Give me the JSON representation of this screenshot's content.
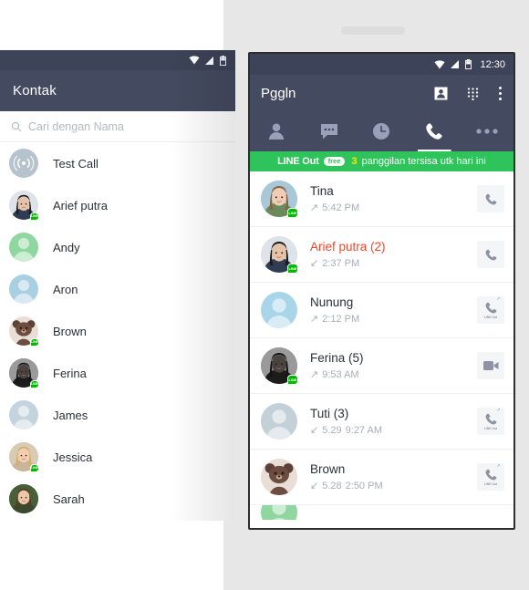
{
  "left_phone": {
    "status_bar": {
      "icons": [
        "wifi-icon",
        "signal-icon",
        "battery-icon"
      ]
    },
    "header": {
      "title": "Kontak"
    },
    "search": {
      "placeholder": "Cari dengan Nama",
      "icon": "search-icon"
    },
    "contacts": [
      {
        "name": "Test Call",
        "avatar": "broadcast",
        "avatar_color": "#b6c2cc",
        "line_badge": false
      },
      {
        "name": "Arief putra",
        "avatar": "photo-man",
        "avatar_color": "#d9dde2",
        "line_badge": true
      },
      {
        "name": "Andy",
        "avatar": "person",
        "avatar_color": "#8fd6a0",
        "line_badge": false
      },
      {
        "name": "Aron",
        "avatar": "person",
        "avatar_color": "#a9cfe2",
        "line_badge": false
      },
      {
        "name": "Brown",
        "avatar": "bear",
        "avatar_color": "#e8ded5",
        "line_badge": true
      },
      {
        "name": "Ferina",
        "avatar": "photo-dark",
        "avatar_color": "#3a3a3a",
        "line_badge": true
      },
      {
        "name": "James",
        "avatar": "person",
        "avatar_color": "#c3d4de",
        "line_badge": false
      },
      {
        "name": "Jessica",
        "avatar": "photo-blonde",
        "avatar_color": "#e3c9a6",
        "line_badge": true
      },
      {
        "name": "Sarah",
        "avatar": "photo-brunette",
        "avatar_color": "#5c6b4a",
        "line_badge": false
      }
    ]
  },
  "right_phone": {
    "status_bar": {
      "time": "12:30",
      "icons": [
        "wifi-icon",
        "signal-icon",
        "battery-icon"
      ]
    },
    "header": {
      "title": "Pggln",
      "icons": [
        "contact-card-icon",
        "dialpad-icon",
        "overflow-menu-icon"
      ]
    },
    "tabs": [
      {
        "name": "friends",
        "icon": "person-icon",
        "active": false
      },
      {
        "name": "chats",
        "icon": "chat-bubble-icon",
        "active": false
      },
      {
        "name": "timeline",
        "icon": "clock-icon",
        "active": false
      },
      {
        "name": "calls",
        "icon": "phone-icon",
        "active": true
      },
      {
        "name": "more",
        "icon": "more-dots-icon",
        "active": false
      }
    ],
    "banner": {
      "brand": "LINE Out",
      "free_label": "free",
      "count": "3",
      "text": "panggilan tersisa utk hari ini",
      "bg_color": "#2fc45b",
      "count_color": "#ffe600"
    },
    "calls": [
      {
        "name": "Tina",
        "direction": "outgoing",
        "date": "",
        "time": "5:42 PM",
        "missed": false,
        "action": "voice-call",
        "action_label": "",
        "avatar": "photo-girl",
        "avatar_color": "#c9b8aa",
        "line_badge": true
      },
      {
        "name": "Arief putra (2)",
        "direction": "incoming",
        "date": "",
        "time": "2:37 PM",
        "missed": true,
        "action": "voice-call",
        "action_label": "",
        "avatar": "photo-man",
        "avatar_color": "#d9dde2",
        "line_badge": true
      },
      {
        "name": "Nunung",
        "direction": "outgoing",
        "date": "",
        "time": "2:12 PM",
        "missed": false,
        "action": "line-out",
        "action_label": "LINE Out",
        "avatar": "person",
        "avatar_color": "#a9d5e8",
        "line_badge": false
      },
      {
        "name": "Ferina (5)",
        "direction": "outgoing",
        "date": "",
        "time": "9:53 AM",
        "missed": false,
        "action": "video-call",
        "action_label": "",
        "avatar": "photo-dark",
        "avatar_color": "#3a3a3a",
        "line_badge": true
      },
      {
        "name": "Tuti (3)",
        "direction": "incoming",
        "date": "5.29",
        "time": "9:27 AM",
        "missed": false,
        "action": "line-out",
        "action_label": "LINE Out",
        "avatar": "person",
        "avatar_color": "#c3d0d8",
        "line_badge": false
      },
      {
        "name": "Brown",
        "direction": "incoming",
        "date": "5.28",
        "time": "2:50 PM",
        "missed": false,
        "action": "line-out",
        "action_label": "LINE Out",
        "avatar": "bear",
        "avatar_color": "#e8ded5",
        "line_badge": false
      }
    ],
    "arrows": {
      "outgoing": "↗",
      "incoming": "↙"
    }
  },
  "colors": {
    "header_bg": "#444a60",
    "status_bg": "#3d4358",
    "banner_green": "#2fc45b",
    "line_green": "#00b900",
    "missed_red": "#f4452a",
    "backdrop": "#e7e7e7"
  }
}
